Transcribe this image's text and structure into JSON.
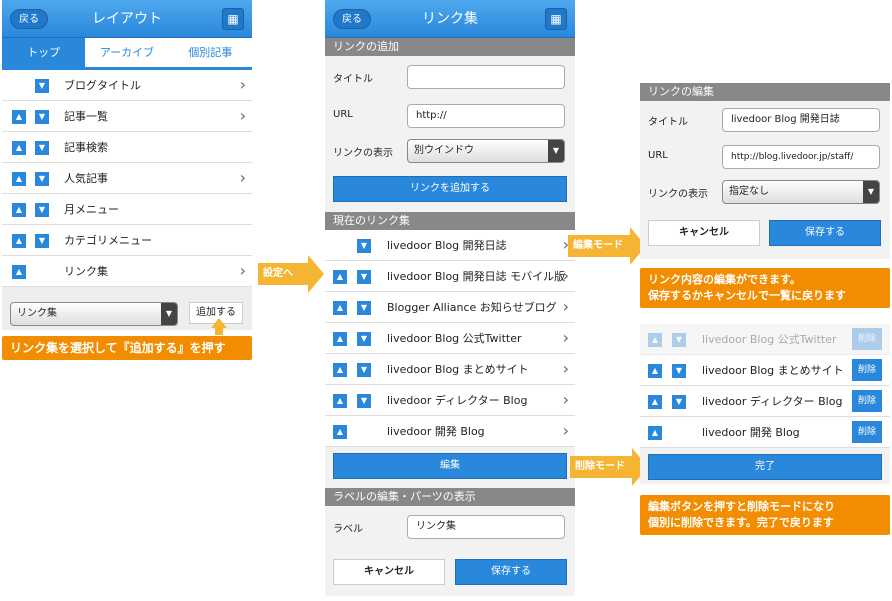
{
  "p1": {
    "back": "戻る",
    "title": "レイアウト",
    "tabs": [
      "トップ",
      "アーカイブ",
      "個別記事"
    ],
    "rows": [
      "ブログタイトル",
      "記事一覧",
      "記事検索",
      "人気記事",
      "月メニュー",
      "カテゴリメニュー",
      "リンク集"
    ],
    "select": "リンク集",
    "add": "追加する",
    "note": "リンク集を選択して『追加する』を押す"
  },
  "arrow1": "設定へ",
  "p2": {
    "back": "戻る",
    "title": "リンク集",
    "sec_add": "リンクの追加",
    "lbl_title": "タイトル",
    "lbl_url": "URL",
    "url_val": "http://",
    "lbl_disp": "リンクの表示",
    "disp_val": "別ウインドウ",
    "add_btn": "リンクを追加する",
    "sec_cur": "現在のリンク集",
    "links": [
      "livedoor Blog 開発日誌",
      "livedoor Blog 開発日誌 モバイル版",
      "Blogger Alliance お知らせブログ",
      "livedoor Blog 公式Twitter",
      "livedoor Blog まとめサイト",
      "livedoor ディレクター Blog",
      "livedoor 開発 Blog"
    ],
    "edit_btn": "編集",
    "sec_label": "ラベルの編集・パーツの表示",
    "lbl_label": "ラベル",
    "label_val": "リンク集",
    "cancel": "キャンセル",
    "save": "保存する"
  },
  "arrow2": "編集モードへ",
  "arrow3": "削除モードへ",
  "p3": {
    "sec": "リンクの編集",
    "lbl_title": "タイトル",
    "title_val": "livedoor Blog 開発日誌",
    "lbl_url": "URL",
    "url_val": "http://blog.livedoor.jp/staff/",
    "lbl_disp": "リンクの表示",
    "disp_val": "指定なし",
    "cancel": "キャンセル",
    "save": "保存する",
    "note": [
      "リンク内容の編集ができます。",
      "保存するかキャンセルで一覧に戻ります"
    ]
  },
  "p4": {
    "links": [
      "livedoor Blog 公式Twitter",
      "livedoor Blog まとめサイト",
      "livedoor ディレクター Blog",
      "livedoor 開発 Blog"
    ],
    "del": "削除",
    "done": "完了",
    "note": [
      "編集ボタンを押すと削除モードになり",
      "個別に削除できます。完了で戻ります"
    ]
  }
}
